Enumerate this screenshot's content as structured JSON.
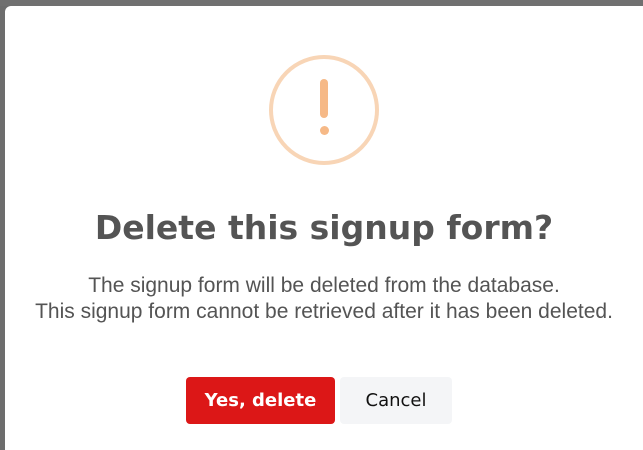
{
  "dialog": {
    "icon": "warning-exclamation-icon",
    "title": "Delete this signup form?",
    "message_line1": "The signup form will be deleted from the database.",
    "message_line2": "This signup form cannot be retrieved after it has been deleted.",
    "confirm_label": "Yes, delete",
    "cancel_label": "Cancel"
  },
  "colors": {
    "confirm": "#dc1717",
    "warning_icon": "#f6b987",
    "cancel_bg": "#f4f5f7",
    "text": "#545454"
  }
}
